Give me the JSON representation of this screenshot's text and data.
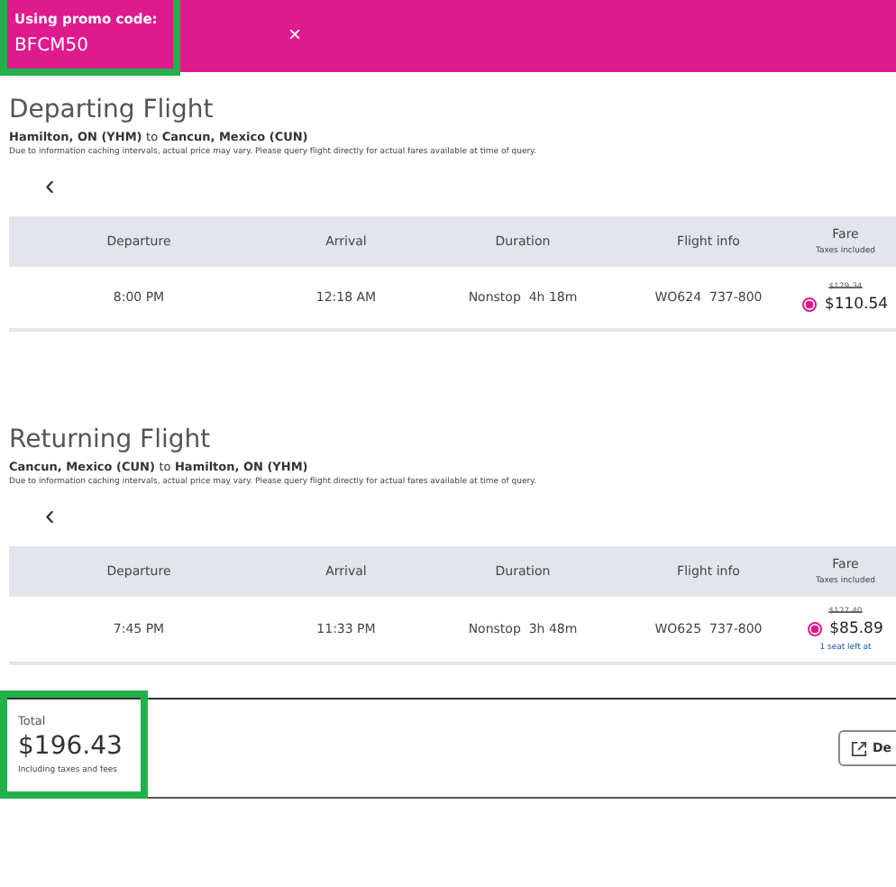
{
  "promo": {
    "label": "Using promo code:",
    "code": "BFCM50",
    "highlighted": true,
    "close": "×"
  },
  "flights": [
    {
      "title": "Departing Flight",
      "from": "Hamilton, ON (YHM)",
      "to_word": "to",
      "to": "Cancun, Mexico (CUN)",
      "disclaimer": "Due to information caching intervals, actual price may vary. Please query flight directly for actual fares available at time of query.",
      "prev": "‹",
      "columns": [
        "Departure",
        "Arrival",
        "Duration",
        "Flight info"
      ],
      "fare_header": "Fare",
      "fare_sub": "Taxes included",
      "row": {
        "departure": "8:00 PM",
        "arrival": "12:18 AM",
        "stops": "Nonstop",
        "duration": "4h 18m",
        "flight": "WO624",
        "aircraft": "737-800",
        "old_price": "$129.34",
        "price": "$110.54",
        "selected": true
      }
    },
    {
      "title": "Returning Flight",
      "from": "Cancun, Mexico (CUN)",
      "to_word": "to",
      "to": "Hamilton, ON (YHM)",
      "disclaimer": "Due to information caching intervals, actual price may vary. Please query flight directly for actual fares available at time of query.",
      "prev": "‹",
      "columns": [
        "Departure",
        "Arrival",
        "Duration",
        "Flight info"
      ],
      "fare_header": "Fare",
      "fare_sub": "Taxes included",
      "row": {
        "departure": "7:45 PM",
        "arrival": "11:33 PM",
        "stops": "Nonstop",
        "duration": "3h 48m",
        "flight": "WO625",
        "aircraft": "737-800",
        "old_price": "$127.40",
        "price": "$85.89",
        "selected": true,
        "seats": "1 seat left at"
      }
    }
  ],
  "total": {
    "label": "Total",
    "amount": "$196.43",
    "note": "Including taxes and fees",
    "highlighted": true,
    "button": "De"
  }
}
